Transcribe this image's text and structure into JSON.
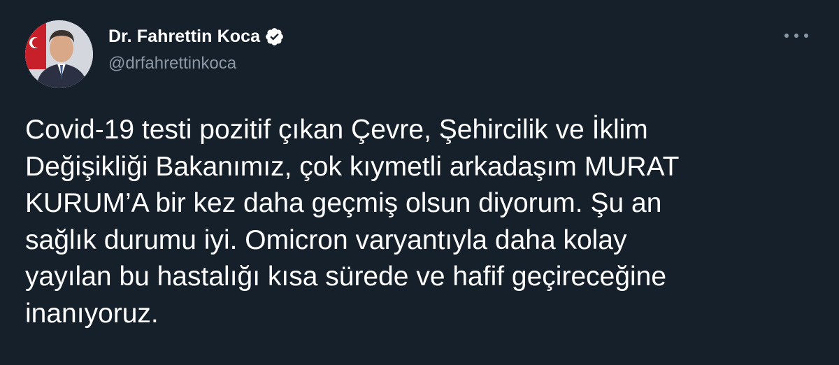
{
  "author": {
    "display_name": "Dr. Fahrettin Koca",
    "handle": "@drfahrettinkoca",
    "verified": true
  },
  "icons": {
    "verified": "verified-badge-icon",
    "more": "more-horizontal-icon"
  },
  "tweet": {
    "lines": [
      "Covid-19 testi pozitif çıkan Çevre, Şehircilik ve İklim",
      "Değişikliği Bakanımız, çok kıymetli arkadaşım MURAT",
      "KURUM’A bir kez daha geçmiş olsun diyorum. Şu an",
      "sağlık durumu iyi. Omicron varyantıyla daha kolay",
      "yayılan bu hastalığı kısa sürede ve hafif geçireceğine",
      "inanıyoruz."
    ]
  },
  "colors": {
    "background": "#15202b",
    "text": "#ffffff",
    "secondary_text": "#8b98a5",
    "verified_badge": "#ffffff"
  }
}
